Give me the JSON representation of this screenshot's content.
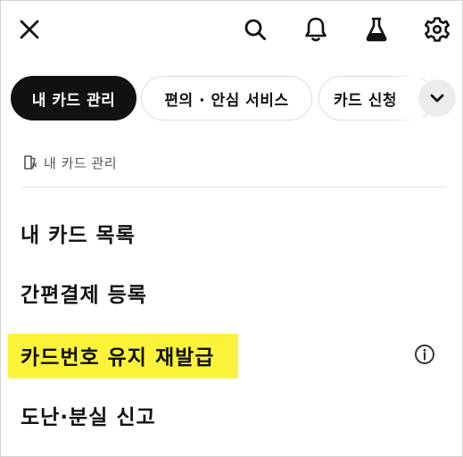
{
  "header": {
    "icons": [
      "close-icon",
      "search-icon",
      "bell-icon",
      "flask-icon",
      "gear-icon"
    ]
  },
  "tabs": [
    {
      "label": "내 카드 관리",
      "active": true
    },
    {
      "label": "편의 · 안심 서비스",
      "active": false
    },
    {
      "label": "카드 신청",
      "active": false
    }
  ],
  "breadcrumb": {
    "label": "내 카드 관리"
  },
  "menu": [
    {
      "label": "내 카드 목록"
    },
    {
      "label": "간편결제 등록"
    },
    {
      "label": "카드번호 유지 재발급",
      "highlighted": true,
      "has_info": true
    },
    {
      "label": "도난·분실 신고"
    }
  ],
  "colors": {
    "active_tab_bg": "#111111",
    "highlight": "#fbf33a",
    "divider": "#e3e3e3"
  }
}
